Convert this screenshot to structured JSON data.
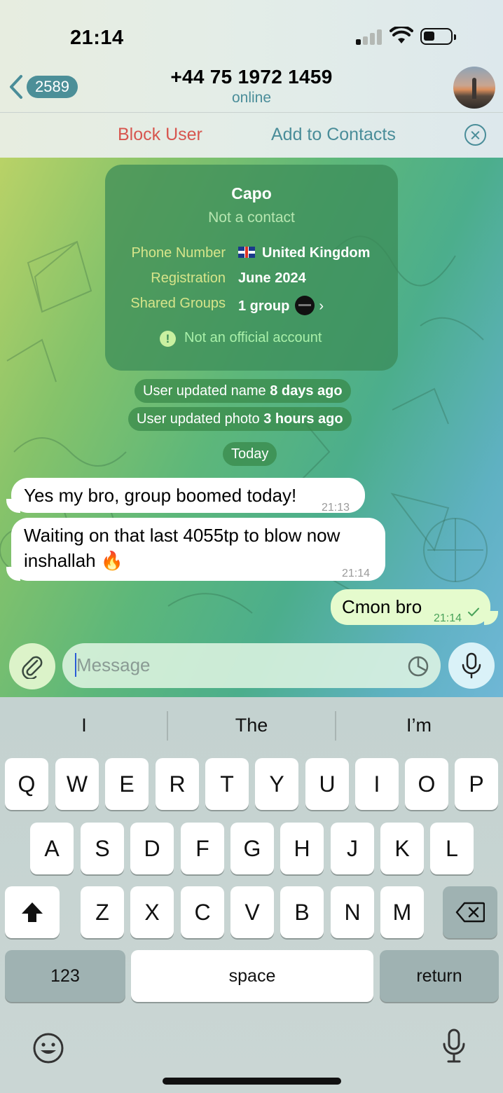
{
  "status_bar": {
    "time": "21:14"
  },
  "header": {
    "back_badge": "2589",
    "title": "+44 75 1972 1459",
    "subtitle": "online"
  },
  "action_bar": {
    "block_label": "Block User",
    "add_label": "Add to Contacts"
  },
  "info_card": {
    "name": "Capo",
    "status": "Not a contact",
    "rows": [
      {
        "label": "Phone Number",
        "value": "United Kingdom"
      },
      {
        "label": "Registration",
        "value": "June 2024"
      },
      {
        "label": "Shared Groups",
        "value": "1 group"
      }
    ],
    "warning_icon": "!",
    "warning": "Not an official account"
  },
  "service_messages": [
    {
      "text": "User updated name ",
      "bold": "8 days ago"
    },
    {
      "text": "User updated photo ",
      "bold": "3 hours ago"
    }
  ],
  "date_pill": "Today",
  "messages": [
    {
      "direction": "in",
      "lines": [
        "Yes my bro, group boomed today!"
      ],
      "time": "21:13"
    },
    {
      "direction": "in",
      "lines": [
        "Waiting on that last 4055tp to blow now",
        "inshallah 🔥"
      ],
      "time": "21:14"
    },
    {
      "direction": "out",
      "lines": [
        "Cmon bro"
      ],
      "time": "21:14",
      "status_icon": "single-check-icon"
    }
  ],
  "composer": {
    "placeholder": "Message"
  },
  "keyboard": {
    "suggestions": [
      "I",
      "The",
      "I’m"
    ],
    "row1": [
      "Q",
      "W",
      "E",
      "R",
      "T",
      "Y",
      "U",
      "I",
      "O",
      "P"
    ],
    "row2": [
      "A",
      "S",
      "D",
      "F",
      "G",
      "H",
      "J",
      "K",
      "L"
    ],
    "row3": [
      "Z",
      "X",
      "C",
      "V",
      "B",
      "N",
      "M"
    ],
    "numbers_label": "123",
    "space_label": "space",
    "return_label": "return"
  },
  "colors": {
    "accent": "#4a8d99",
    "danger": "#d7564f",
    "outgoing_bubble": "#e5fbcd"
  }
}
